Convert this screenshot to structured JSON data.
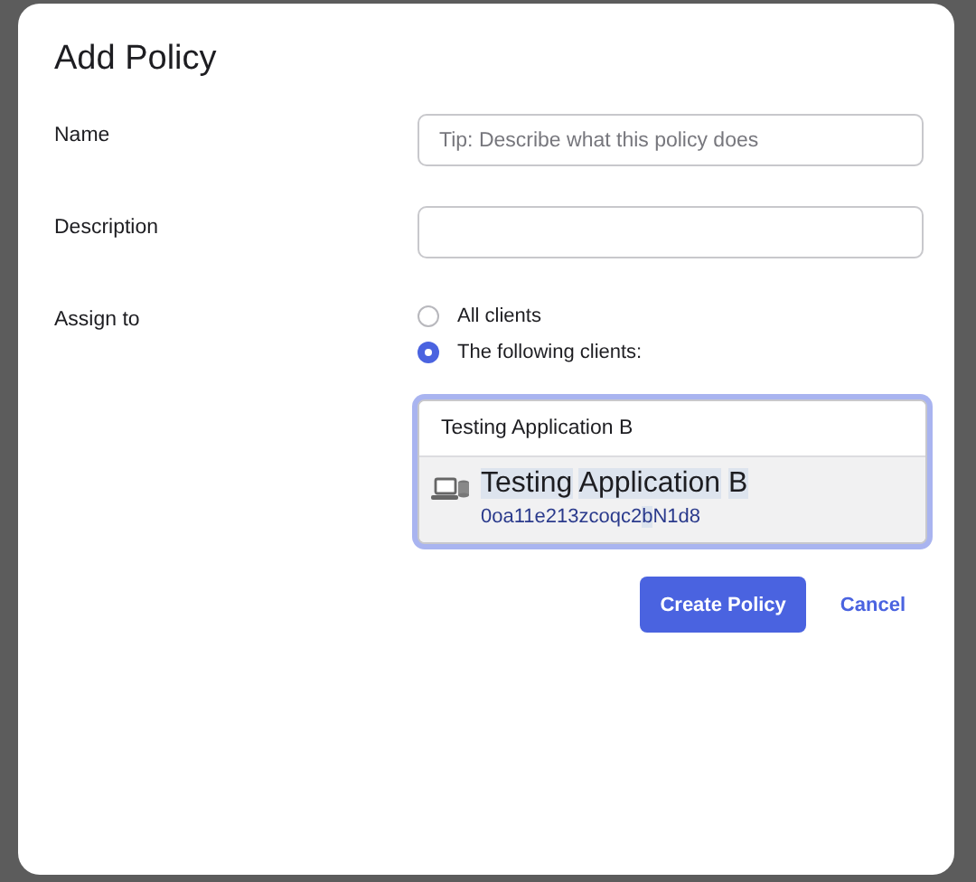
{
  "dialog": {
    "title": "Add Policy"
  },
  "fields": [
    {
      "kind": "text",
      "label": "Name",
      "placeholder": "Tip: Describe what this policy does"
    },
    {
      "kind": "text",
      "label": "Description"
    },
    {
      "kind": "assign",
      "label": "Assign to",
      "options": [
        {
          "label": "All clients",
          "selected": false
        },
        {
          "label": "The following clients:",
          "selected": true
        }
      ],
      "search": {
        "value": "Testing Application B",
        "focused": true,
        "results": [
          {
            "title": [
              {
                "text": "Testing",
                "match": true
              },
              {
                "text": "Application",
                "match": true
              },
              {
                "text": "B",
                "match": true
              }
            ],
            "id": [
              {
                "text": "0oa11e213zcoqc2",
                "match": false
              },
              {
                "text": "b",
                "match": true
              },
              {
                "text": "N1d8",
                "match": false
              }
            ]
          }
        ]
      }
    }
  ],
  "buttons": [
    {
      "kind": "primary",
      "label": "Create Policy"
    },
    {
      "kind": "link",
      "label": "Cancel"
    }
  ]
}
